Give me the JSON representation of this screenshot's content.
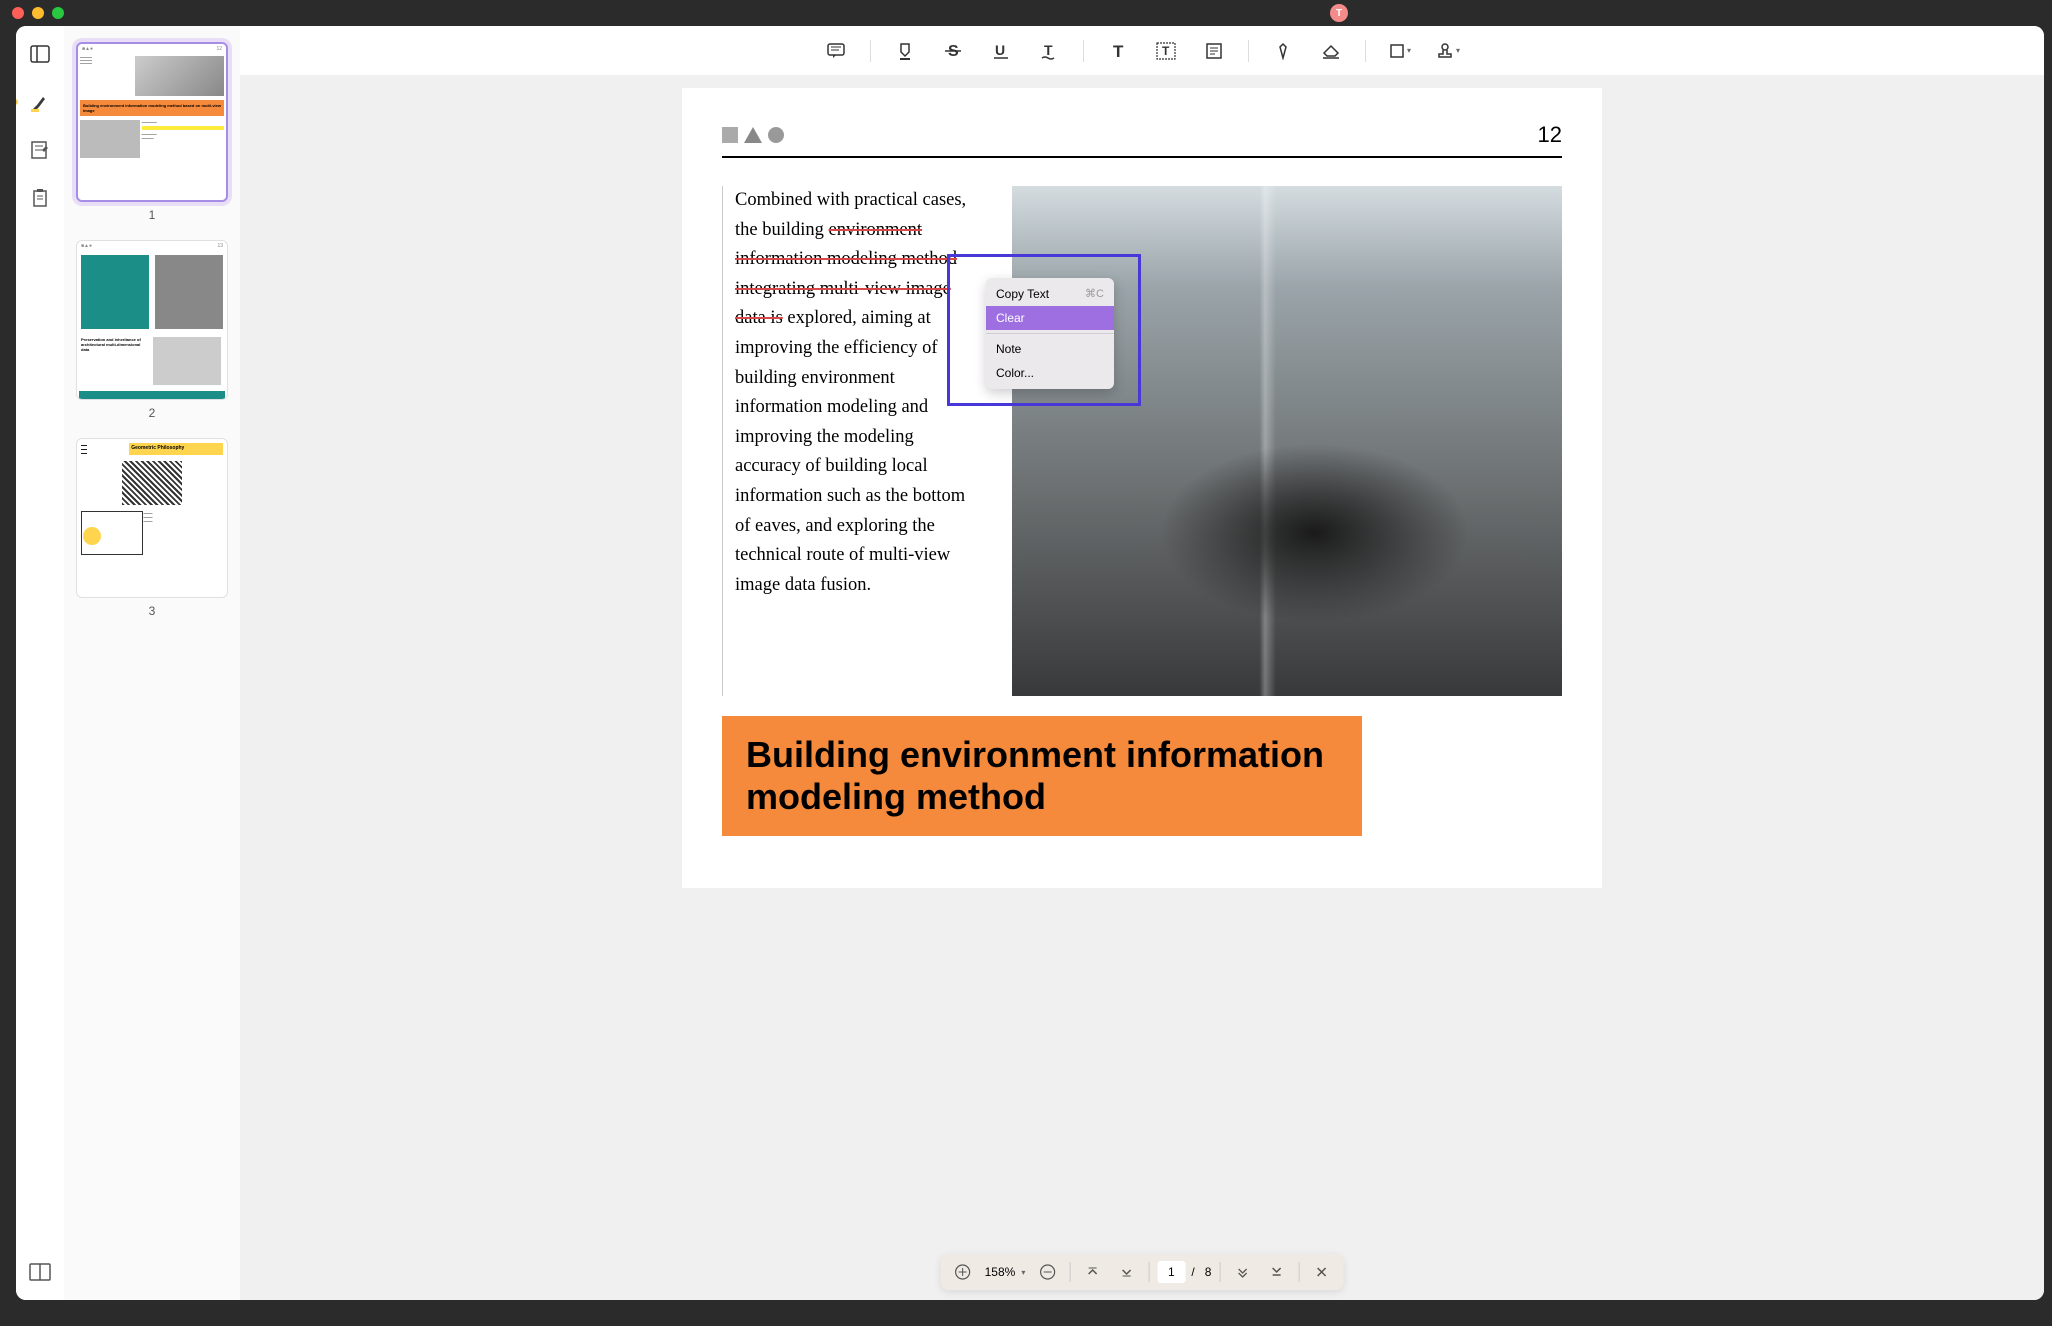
{
  "traffic": {
    "user_initial": "T"
  },
  "thumbs": [
    {
      "num": "1",
      "title": "Building environment information modeling method based on multi-view image"
    },
    {
      "num": "2",
      "title": "Preservation and inheritance of architectural multi-dimensional data"
    },
    {
      "num": "3",
      "title": "Geometric Philosophy"
    }
  ],
  "page": {
    "number": "12",
    "paragraph": "Combined with practical cases, the building environment information modeling method integrating multi-view image data is explored, aiming at improving the efficiency of building environment information modeling and improving the modeling accuracy of building local information such as the bottom of eaves, and exploring the technical route of multi-view image data fusion.",
    "struck_part": "environment information modeling method integrating multi-view image data is",
    "banner": "Building environment information modeling method"
  },
  "ctx": {
    "copy": "Copy Text",
    "copy_kbd": "⌘C",
    "clear": "Clear",
    "note": "Note",
    "color": "Color..."
  },
  "pager": {
    "zoom": "158%",
    "current": "1",
    "sep": "/",
    "total": "8"
  }
}
